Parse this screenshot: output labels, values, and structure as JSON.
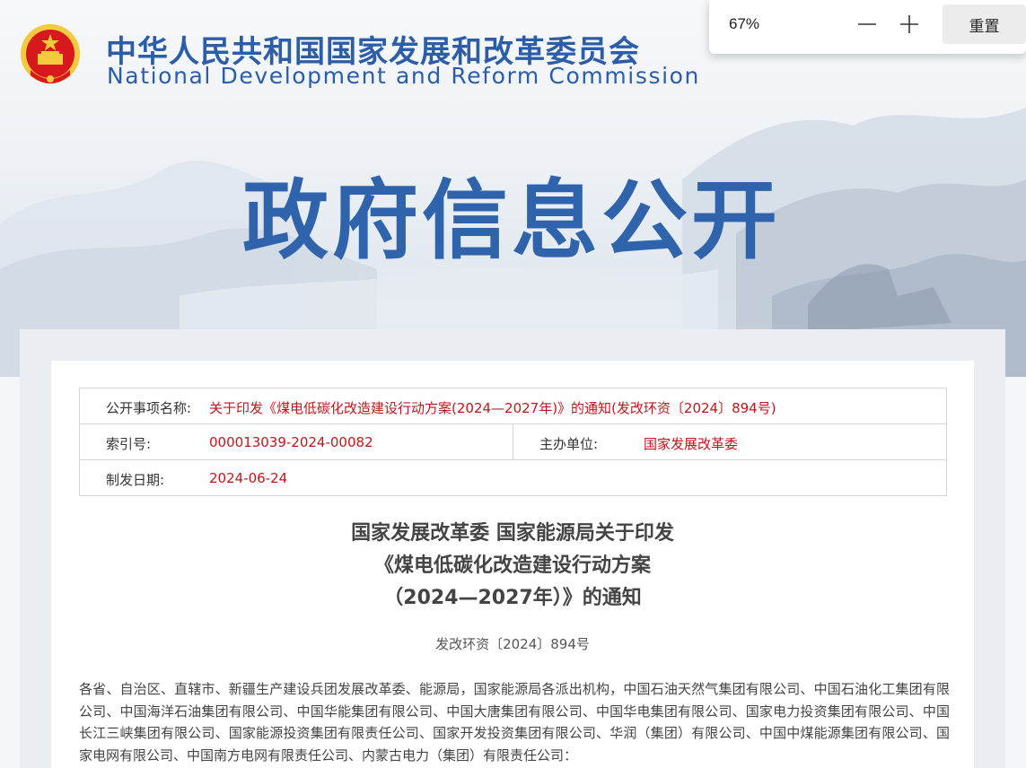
{
  "site": {
    "org_name_cn": "中华人民共和国国家发展和改革委员会",
    "org_name_en": "National Development and Reform Commission",
    "section_title": "政府信息公开",
    "emblem_icon": "national-emblem-icon"
  },
  "zoom_popup": {
    "zoom_level": "67%",
    "zoom_out_icon": "minus-icon",
    "zoom_in_icon": "plus-icon",
    "reset_label": "重置"
  },
  "meta": {
    "title_label": "公开事项名称:",
    "title_value": "关于印发《煤电低碳化改造建设行动方案(2024—2027年)》的通知(发改环资〔2024〕894号)",
    "index_label": "索引号:",
    "index_value": "000013039-2024-00082",
    "issuer_label": "主办单位:",
    "issuer_value": "国家发展改革委",
    "date_label": "制发日期:",
    "date_value": "2024-06-24"
  },
  "document": {
    "title_lines": [
      "国家发展改革委 国家能源局关于印发",
      "《煤电低碳化改造建设行动方案",
      "（2024—2027年）》的通知"
    ],
    "doc_number": "发改环资〔2024〕894号",
    "recipients": "各省、自治区、直辖市、新疆生产建设兵团发展改革委、能源局，国家能源局各派出机构，中国石油天然气集团有限公司、中国石油化工集团有限公司、中国海洋石油集团有限公司、中国华能集团有限公司、中国大唐集团有限公司、中国华电集团有限公司、国家电力投资集团有限公司、中国长江三峡集团有限公司、国家能源投资集团有限责任公司、国家开发投资集团有限公司、华润（集团）有限公司、中国中煤能源集团有限公司、国家电网有限公司、中国南方电网有限责任公司、内蒙古电力（集团）有限责任公司："
  },
  "colors": {
    "brand_blue": "#2b5da8",
    "value_red": "#c0161b",
    "emblem_red": "#d7191d",
    "emblem_gold": "#f3c93d"
  }
}
